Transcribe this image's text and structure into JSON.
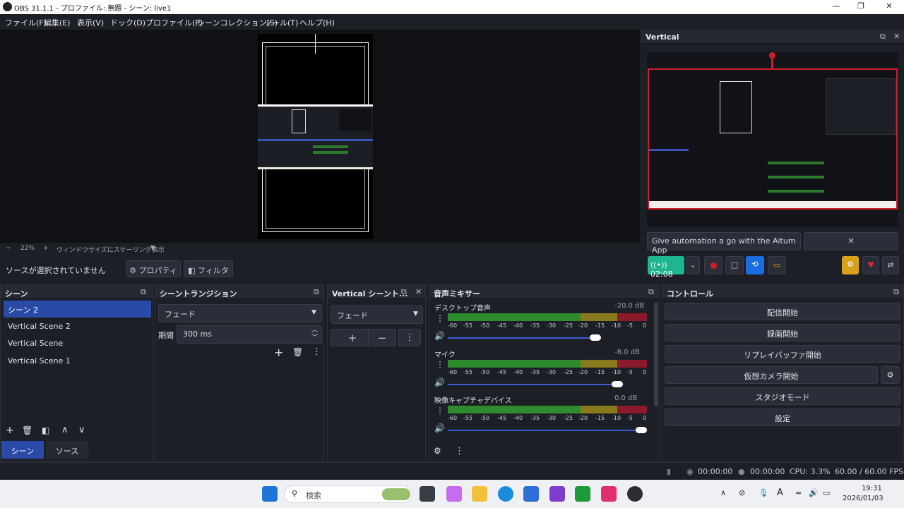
{
  "window": {
    "title": "OBS 31.1.1 - プロファイル: 無題 - シーン: live1",
    "minimize": "—",
    "maximize": "❐",
    "close": "✕"
  },
  "menu": [
    "ファイル(F)",
    "編集(E)",
    "表示(V)",
    "ドック(D)",
    "プロファイル(P)",
    "シーンコレクション(S)",
    "ツール(T)",
    "ヘルプ(H)"
  ],
  "zoom": {
    "minus": "−",
    "value": "22%",
    "plus": "+",
    "mode": "ウィンドウサイズにスケーリング表示"
  },
  "source_bar": {
    "status": "ソースが選択されていません",
    "properties": "⚙ プロパティ",
    "filters": "◧ フィルタ"
  },
  "vertical": {
    "title": "Vertical",
    "banner": "Give automation a go with the Aitum App",
    "banner_close": "✕",
    "live_time": "((•)) 02:08"
  },
  "scenes": {
    "title": "シーン",
    "items": [
      "シーン 2",
      "Vertical Scene 2",
      "Vertical Scene",
      "Vertical Scene 1"
    ],
    "tab_scenes": "シーン",
    "tab_sources": "ソース"
  },
  "transitions": {
    "title": "シーントランジション",
    "type": "フェード",
    "duration_label": "期間",
    "duration": "300 ms"
  },
  "vtransitions": {
    "title": "Vertical シーント...",
    "type": "フェード"
  },
  "mixer": {
    "title": "音声ミキサー",
    "channels": [
      {
        "name": "デスクトップ音声",
        "db": "-20.0 dB",
        "volume": 0.77
      },
      {
        "name": "マイク",
        "db": "-8.0 dB",
        "volume": 0.88
      },
      {
        "name": "映像キャプチャデバイス",
        "db": "0.0 dB",
        "volume": 1.0
      }
    ],
    "ticks": [
      "-60",
      "-55",
      "-50",
      "-45",
      "-40",
      "-35",
      "-30",
      "-25",
      "-20",
      "-15",
      "-10",
      "-5",
      "0"
    ]
  },
  "controls": {
    "title": "コントロール",
    "buttons": [
      "配信開始",
      "録画開始",
      "リプレイバッファ開始",
      "仮想カメラ開始",
      "スタジオモード",
      "設定"
    ]
  },
  "status": {
    "live": "00:00:00",
    "rec": "00:00:00",
    "cpu": "CPU: 3.3%",
    "fps": "60.00 / 60.00 FPS"
  },
  "taskbar": {
    "search": "検索",
    "time": "19:31",
    "date": "2026/01/03"
  },
  "colors": {
    "accent": "#2a4aa8",
    "live": "#1fb58f",
    "meter_green": "#2e8b2e",
    "meter_yellow": "#8a7a1e",
    "meter_red": "#8b1a2a"
  }
}
